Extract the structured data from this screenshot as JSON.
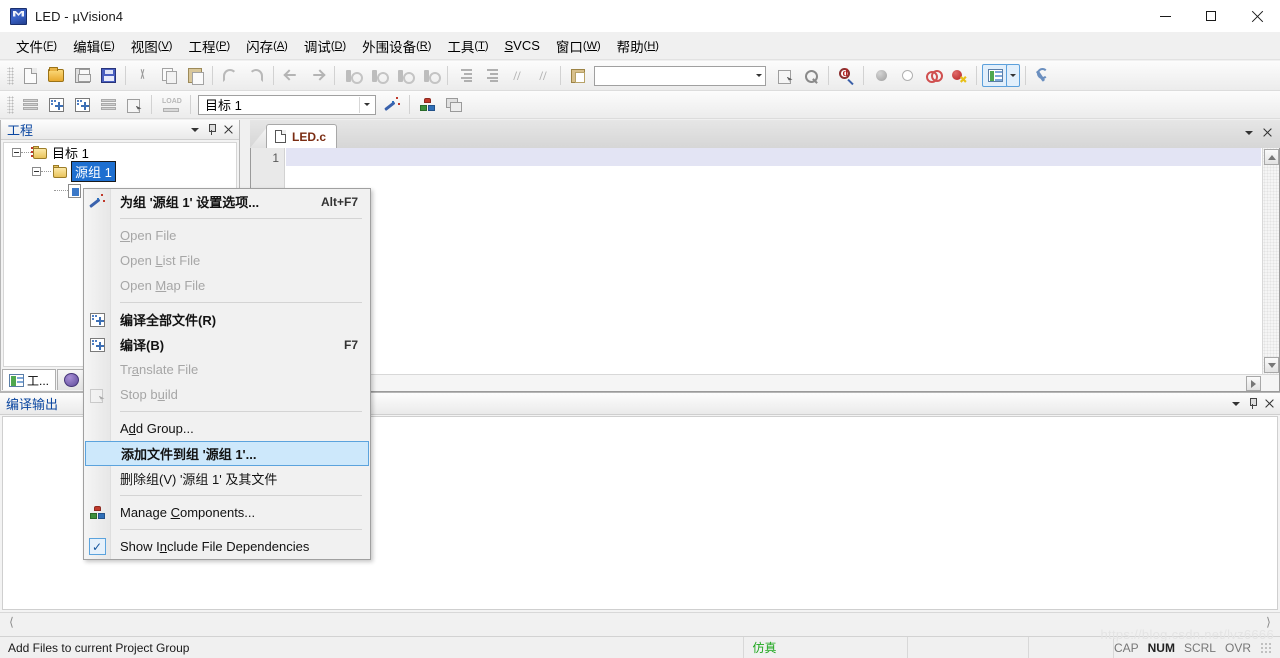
{
  "window": {
    "title": "LED  - µVision4",
    "icon": "uvision-logo-icon",
    "minimize": "minimize",
    "maximize": "maximize",
    "close": "close"
  },
  "menubar": {
    "items": [
      {
        "label": "文件",
        "mnemonic": "F"
      },
      {
        "label": "编辑",
        "mnemonic": "E"
      },
      {
        "label": "视图",
        "mnemonic": "V"
      },
      {
        "label": "工程",
        "mnemonic": "P"
      },
      {
        "label": "闪存",
        "mnemonic": "A"
      },
      {
        "label": "调试",
        "mnemonic": "D"
      },
      {
        "label": "外围设备",
        "mnemonic": "R"
      },
      {
        "label": "工具",
        "mnemonic": "T"
      },
      {
        "label": "SVCS",
        "mnemonic": "S",
        "prefix": true
      },
      {
        "label": "窗口",
        "mnemonic": "W"
      },
      {
        "label": "帮助",
        "mnemonic": "H"
      }
    ]
  },
  "toolbar_main": {
    "buttons": [
      "new-file-icon",
      "open-file-icon",
      "save-icon",
      "save-all-icon",
      "cut-icon",
      "copy-icon",
      "paste-icon",
      "undo-icon",
      "redo-icon",
      "navigate-back-icon",
      "navigate-forward-icon",
      "bookmark-toggle-icon",
      "bookmark-next-icon",
      "bookmark-prev-icon",
      "bookmark-clear-icon",
      "indent-icon",
      "outdent-icon",
      "comment-icon",
      "uncomment-icon",
      "open-project-workspace-icon"
    ],
    "search_value": "",
    "search_placeholder": "",
    "right_buttons": [
      "find-in-files-icon",
      "binoculars-icon",
      "debug-query-icon",
      "breakpoint-solid-icon",
      "breakpoint-hollow-icon",
      "breakpoint-disable-icon",
      "breakpoint-kill-icon"
    ],
    "window_button": "manage-window-layout-icon",
    "config_button": "configure-toolbar-icon"
  },
  "toolbar_build": {
    "buttons": [
      "translate-file-icon",
      "build-target-icon",
      "rebuild-all-icon",
      "batch-build-icon",
      "stop-build-icon",
      "download-to-flash-icon"
    ],
    "target_select": {
      "value": "目标 1",
      "label": "target-selector"
    },
    "after_buttons": [
      "target-options-icon",
      "manage-components-icon",
      "multi-project-icon"
    ]
  },
  "project_dock": {
    "title": "工程",
    "menu_button": "dock-menu-icon",
    "pin_button": "auto-hide-pin-icon",
    "close_button": "close-icon",
    "tree": [
      {
        "label": "目标 1",
        "type": "target",
        "expanded": true,
        "selected": false
      },
      {
        "label": "源组 1",
        "type": "group",
        "expanded": true,
        "selected": true
      },
      {
        "label": "",
        "type": "file",
        "expanded": false,
        "selected": false
      }
    ],
    "tabs": [
      {
        "label": "工...",
        "icon": "project-pane-icon",
        "active": true
      },
      {
        "label": "",
        "icon": "books-pane-icon",
        "active": false
      }
    ]
  },
  "editor": {
    "tabs": [
      {
        "label": "LED.c",
        "icon": "file-icon",
        "active": true
      }
    ],
    "menu_button": "editor-menu-icon",
    "close_button": "editor-close-icon",
    "line_numbers": [
      "1"
    ],
    "content": ""
  },
  "build_dock": {
    "title": "编译输出",
    "menu_button": "dock-menu-icon",
    "pin_button": "auto-hide-pin-icon",
    "close_button": "close-icon",
    "content": ""
  },
  "context_menu": {
    "items": [
      {
        "label": "为组 '源组 1' 设置选项...",
        "accel": "Alt+F7",
        "icon": "target-options-icon",
        "state": "bold"
      },
      {
        "separator": true
      },
      {
        "label": "Open File",
        "accel": "",
        "icon": "",
        "state": "disabled",
        "mnemonic": "O"
      },
      {
        "label": "Open List File",
        "accel": "",
        "icon": "",
        "state": "disabled",
        "mnemonic": "L"
      },
      {
        "label": "Open Map File",
        "accel": "",
        "icon": "",
        "state": "disabled",
        "mnemonic": "M"
      },
      {
        "separator": true
      },
      {
        "label": "编译全部文件(R)",
        "accel": "",
        "icon": "rebuild-all-icon",
        "state": "bold"
      },
      {
        "label": "编译(B)",
        "accel": "F7",
        "icon": "build-target-icon",
        "state": "bold"
      },
      {
        "label": "Translate File",
        "accel": "",
        "icon": "",
        "state": "disabled",
        "mnemonic": "a"
      },
      {
        "label": "Stop build",
        "accel": "",
        "icon": "stop-build-icon",
        "state": "disabled",
        "mnemonic": "u"
      },
      {
        "separator": true
      },
      {
        "label": "Add Group...",
        "accel": "",
        "icon": "",
        "state": "normal",
        "mnemonic": "d"
      },
      {
        "label": "添加文件到组 '源组 1'...",
        "accel": "",
        "icon": "",
        "state": "highlighted-bold"
      },
      {
        "label": "删除组(V) '源组 1' 及其文件",
        "accel": "",
        "icon": "",
        "state": "normal"
      },
      {
        "separator": true
      },
      {
        "label": "Manage Components...",
        "accel": "",
        "icon": "manage-components-icon",
        "state": "normal",
        "mnemonic": "C"
      },
      {
        "separator": true
      },
      {
        "label": "Show Include File Dependencies",
        "accel": "",
        "icon": "checkmark-icon",
        "state": "checked",
        "mnemonic": "n"
      }
    ]
  },
  "statusbar": {
    "message": "Add Files to current Project Group",
    "cell2": "",
    "simulation": "仿真",
    "cell4": "",
    "cell5": "",
    "flags": [
      {
        "label": "CAP",
        "active": false
      },
      {
        "label": "NUM",
        "active": true
      },
      {
        "label": "SCRL",
        "active": false
      },
      {
        "label": "OVR",
        "active": false
      }
    ]
  },
  "watermark": "https://blog.csdn.net/lvz6666",
  "colors": {
    "dock_title": "#0a46a0",
    "selection": "#1e6fd0",
    "menu_highlight": "#cde8fb",
    "menu_highlight_border": "#5ba3dd",
    "status_sim": "#1fa81f",
    "tab_text": "#7a2c12",
    "current_line": "#e3e4f4"
  }
}
